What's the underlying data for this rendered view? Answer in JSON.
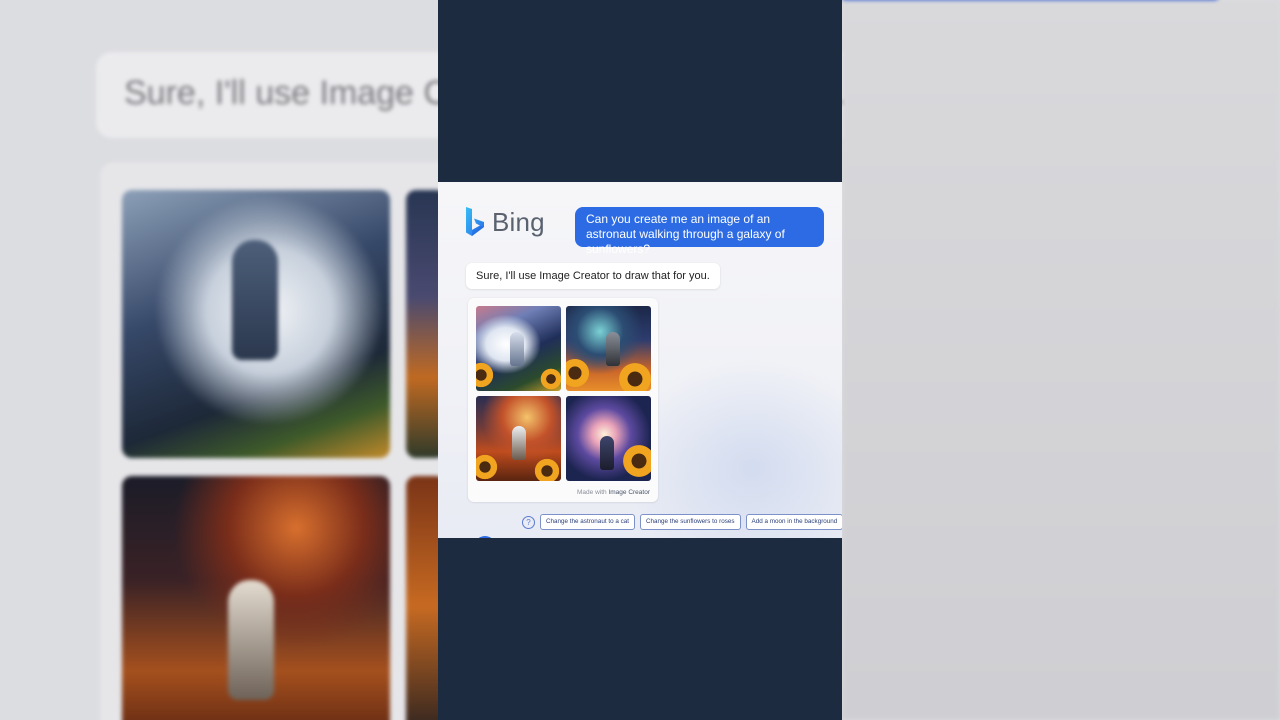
{
  "background": {
    "bubble_text": "Sure, I'll use Image C",
    "bubble_text_tail": "."
  },
  "chat": {
    "brand": "Bing",
    "user_message": "Can you create me an image of an astronaut walking through a galaxy of sunflowers?",
    "bot_message": "Sure, I'll use Image Creator to draw that for you.",
    "made_with_prefix": "Made with ",
    "made_with_link": "Image Creator",
    "suggestions": [
      "Change the astronaut to a cat",
      "Change the sunflowers to roses",
      "Add a moon in the background"
    ],
    "help_icon": "?"
  },
  "colors": {
    "accent": "#2c6be4",
    "dark_column": "#1d2b40"
  },
  "icons": {
    "logo": "bing-logo-icon",
    "help": "question-circle-icon"
  }
}
